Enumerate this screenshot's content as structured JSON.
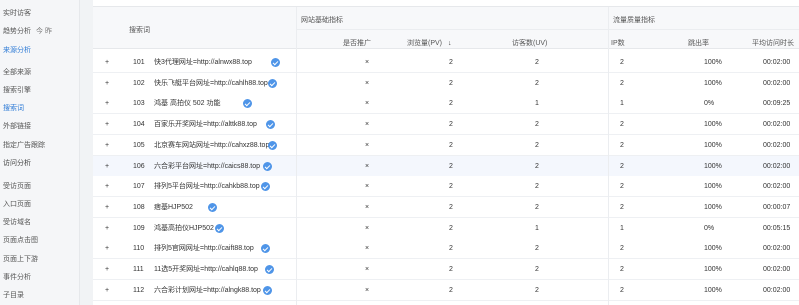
{
  "sidebar": {
    "items": [
      {
        "label": "实时访客",
        "type": "item"
      },
      {
        "label": "趋势分析",
        "extra": "今  昨",
        "type": "item"
      },
      {
        "label": "来源分析",
        "type": "group-active"
      },
      {
        "label": "全部来源",
        "type": "item"
      },
      {
        "label": "搜索引擎",
        "type": "item"
      },
      {
        "label": "搜索词",
        "type": "active"
      },
      {
        "label": "外部链接",
        "type": "item"
      },
      {
        "label": "指定广告跟踪",
        "type": "item"
      },
      {
        "label": "访问分析",
        "type": "group"
      },
      {
        "label": "受访页面",
        "type": "item"
      },
      {
        "label": "入口页面",
        "type": "item"
      },
      {
        "label": "受访域名",
        "type": "item"
      },
      {
        "label": "页面点击图",
        "type": "item"
      },
      {
        "label": "页面上下游",
        "type": "item"
      },
      {
        "label": "事件分析",
        "type": "item"
      },
      {
        "label": "子目录",
        "type": "item"
      }
    ]
  },
  "table": {
    "search_word_header": "搜索词",
    "group1_header": "网站基础指标",
    "group2_header": "流量质量指标",
    "columns": {
      "promoted": "是否推广",
      "pv": "浏览量(PV)",
      "uv": "访客数(UV)",
      "ip": "IP数",
      "bounce": "跳出率",
      "avg_time": "平均访问时长"
    },
    "sort_indicator": "↓",
    "rows": [
      {
        "num": "101",
        "keyword": "快3代理网址=http://alnwx88.top",
        "promoted": "×",
        "pv": "2",
        "uv": "2",
        "ip": "2",
        "bounce": "100%",
        "avg": "00:02:00"
      },
      {
        "num": "102",
        "keyword": "快乐飞艇平台网址=http://cahlh88.top",
        "promoted": "×",
        "pv": "2",
        "uv": "2",
        "ip": "2",
        "bounce": "100%",
        "avg": "00:02:00"
      },
      {
        "num": "103",
        "keyword": "鸿基 高拍仪  502  功能",
        "promoted": "×",
        "pv": "2",
        "uv": "1",
        "ip": "1",
        "bounce": "0%",
        "avg": "00:09:25"
      },
      {
        "num": "104",
        "keyword": "百家乐开奖网址=http://alttk88.top",
        "promoted": "×",
        "pv": "2",
        "uv": "2",
        "ip": "2",
        "bounce": "100%",
        "avg": "00:02:00"
      },
      {
        "num": "105",
        "keyword": "北京赛车网站网址=http://cahxz88.top",
        "promoted": "×",
        "pv": "2",
        "uv": "2",
        "ip": "2",
        "bounce": "100%",
        "avg": "00:02:00"
      },
      {
        "num": "106",
        "keyword": "六合彩平台网址=http://caics88.top",
        "promoted": "×",
        "pv": "2",
        "uv": "2",
        "ip": "2",
        "bounce": "100%",
        "avg": "00:02:00"
      },
      {
        "num": "107",
        "keyword": "排列5平台网址=http://cahkb88.top",
        "promoted": "×",
        "pv": "2",
        "uv": "2",
        "ip": "2",
        "bounce": "100%",
        "avg": "00:02:00"
      },
      {
        "num": "108",
        "keyword": "痞基HJP502",
        "promoted": "×",
        "pv": "2",
        "uv": "2",
        "ip": "2",
        "bounce": "100%",
        "avg": "00:00:07"
      },
      {
        "num": "109",
        "keyword": "鸿基高拍仪HJP502",
        "promoted": "×",
        "pv": "2",
        "uv": "1",
        "ip": "1",
        "bounce": "0%",
        "avg": "00:05:15"
      },
      {
        "num": "110",
        "keyword": "排列5官网网址=http://caift88.top",
        "promoted": "×",
        "pv": "2",
        "uv": "2",
        "ip": "2",
        "bounce": "100%",
        "avg": "00:02:00"
      },
      {
        "num": "111",
        "keyword": "11选5开奖网址=http://cahlq88.top",
        "promoted": "×",
        "pv": "2",
        "uv": "2",
        "ip": "2",
        "bounce": "100%",
        "avg": "00:02:00"
      },
      {
        "num": "112",
        "keyword": "六合彩计划网址=http://alngk88.top",
        "promoted": "×",
        "pv": "2",
        "uv": "2",
        "ip": "2",
        "bounce": "100%",
        "avg": "00:02:00"
      }
    ],
    "icons": {
      "expand": "plus-icon",
      "verified": "verified-check-icon",
      "sort": "arrow-down-icon"
    },
    "colors": {
      "link": "#2e7bd6",
      "highlight_row": "#f4f7fd",
      "header_bg": "#f7f8fa"
    }
  }
}
